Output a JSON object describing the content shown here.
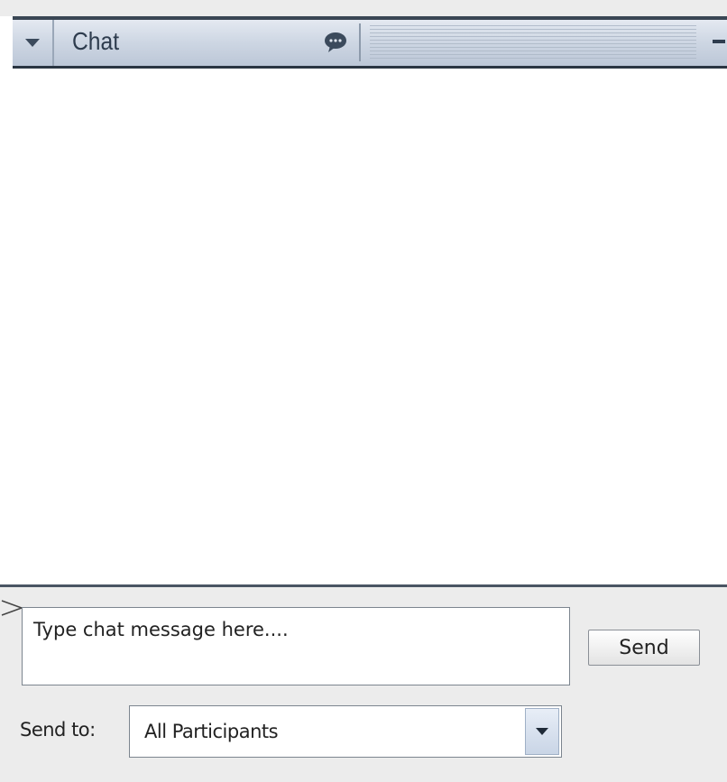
{
  "panel": {
    "title": "Chat",
    "icons": {
      "collapse": "chevron-down-icon",
      "chat": "speech-bubble-icon",
      "minimize": "minimize-icon"
    }
  },
  "compose": {
    "placeholder": "Type chat message here....",
    "send_label": "Send",
    "send_to_label": "Send to:",
    "send_to_value": "All Participants"
  },
  "colors": {
    "header_gradient_top": "#e4e9f1",
    "header_gradient_bottom": "#bcc7d7",
    "header_border": "#3a4654",
    "compose_background": "#ececec"
  }
}
